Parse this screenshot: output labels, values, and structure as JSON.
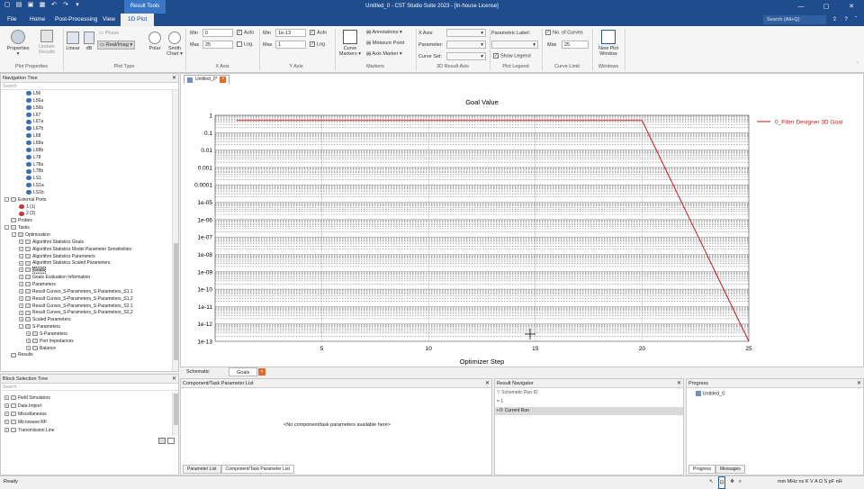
{
  "app": {
    "title": "Untitled_0 - CST Studio Suite 2023 - [In-house License]",
    "context_tab": "Result Tools",
    "search_placeholder": "Search (Alt+Q)"
  },
  "menu": [
    "File",
    "Home",
    "Post-Processing",
    "View",
    "1D Plot"
  ],
  "ribbon": {
    "groups": [
      "Plot Properties",
      "Plot Type",
      "X Axis",
      "Y Axis",
      "Markers",
      "3D Result Axis",
      "Plot Legend",
      "Curve Limit",
      "Windows"
    ],
    "properties": "Properties",
    "update_results": "Update Results",
    "linear": "Linear",
    "db": "dB",
    "phase": "Phase",
    "real_imag": "Real/Imag",
    "polar": "Polar",
    "smith_chart": "Smith Chart",
    "x_min_label": "Min",
    "x_min": "0",
    "x_max_label": "Max",
    "x_max": "25",
    "x_auto": "Auto",
    "x_log": "Log.",
    "y_min_label": "Min",
    "y_min": "1e-13",
    "y_max_label": "Max",
    "y_max": "1",
    "y_auto": "Auto",
    "y_log": "Log",
    "curve_markers": "Curve Markers",
    "annotations": "Annotations",
    "measure_point": "Measure Point",
    "axis_marker": "Axis Marker",
    "x_axis": "X Axis:",
    "parameter": "Parameter:",
    "curve_set": "Curve Set:",
    "parametric_label": "Parametric Label:",
    "show_legend": "Show Legend",
    "no_of_curves": "No. of Curves",
    "curve_max_label": "Max",
    "curve_max": "25",
    "new_plot_window": "New Plot Window"
  },
  "nav_tree": {
    "title": "Navigation Tree",
    "search": "Search",
    "items": [
      {
        "label": "L56",
        "depth": 3,
        "type": "lumped"
      },
      {
        "label": "L56a",
        "depth": 3,
        "type": "lumped"
      },
      {
        "label": "L56b",
        "depth": 3,
        "type": "lumped"
      },
      {
        "label": "L67",
        "depth": 3,
        "type": "lumped"
      },
      {
        "label": "L67a",
        "depth": 3,
        "type": "lumped"
      },
      {
        "label": "L67b",
        "depth": 3,
        "type": "lumped"
      },
      {
        "label": "L68",
        "depth": 3,
        "type": "lumped"
      },
      {
        "label": "L68a",
        "depth": 3,
        "type": "lumped"
      },
      {
        "label": "L68b",
        "depth": 3,
        "type": "lumped"
      },
      {
        "label": "L78",
        "depth": 3,
        "type": "lumped"
      },
      {
        "label": "L78a",
        "depth": 3,
        "type": "lumped"
      },
      {
        "label": "L78b",
        "depth": 3,
        "type": "lumped"
      },
      {
        "label": "LS1",
        "depth": 3,
        "type": "lumped"
      },
      {
        "label": "LS1a",
        "depth": 3,
        "type": "lumped"
      },
      {
        "label": "LS1b",
        "depth": 3,
        "type": "lumped"
      },
      {
        "label": "External Ports",
        "depth": 0,
        "type": "folder",
        "exp": "-"
      },
      {
        "label": "1 (1)",
        "depth": 2,
        "type": "port"
      },
      {
        "label": "2 (2)",
        "depth": 2,
        "type": "port"
      },
      {
        "label": "Probes",
        "depth": 0,
        "type": "folder",
        "exp": ""
      },
      {
        "label": "Tasks",
        "depth": 0,
        "type": "folder",
        "exp": "-"
      },
      {
        "label": "Optimization",
        "depth": 1,
        "type": "task",
        "exp": "-"
      },
      {
        "label": "Algorithm Statistics Goals",
        "depth": 2,
        "type": "result",
        "exp": "+"
      },
      {
        "label": "Algorithm Statistics Model Parameter Sensitivities",
        "depth": 2,
        "type": "result",
        "exp": "+"
      },
      {
        "label": "Algorithm Statistics Parameters",
        "depth": 2,
        "type": "result",
        "exp": "+"
      },
      {
        "label": "Algorithm Statistics Scaled Parameters",
        "depth": 2,
        "type": "result",
        "exp": "+"
      },
      {
        "label": "Goals",
        "depth": 2,
        "type": "result",
        "exp": "+",
        "selected": true
      },
      {
        "label": "Goals Evaluation Information",
        "depth": 2,
        "type": "result",
        "exp": "+"
      },
      {
        "label": "Parameters",
        "depth": 2,
        "type": "result",
        "exp": "+"
      },
      {
        "label": "Result Curves_S-Parameters_S-Parameters_S1,1",
        "depth": 2,
        "type": "result",
        "exp": "+"
      },
      {
        "label": "Result Curves_S-Parameters_S-Parameters_S1,2",
        "depth": 2,
        "type": "result",
        "exp": "+"
      },
      {
        "label": "Result Curves_S-Parameters_S-Parameters_S2,1",
        "depth": 2,
        "type": "result",
        "exp": "+"
      },
      {
        "label": "Result Curves_S-Parameters_S-Parameters_S2,2",
        "depth": 2,
        "type": "result",
        "exp": "+"
      },
      {
        "label": "Scaled Parameters",
        "depth": 2,
        "type": "result",
        "exp": "+"
      },
      {
        "label": "S-Parameters",
        "depth": 2,
        "type": "task",
        "exp": "-"
      },
      {
        "label": "S-Parameters",
        "depth": 3,
        "type": "result",
        "exp": "+"
      },
      {
        "label": "Port Impedances",
        "depth": 3,
        "type": "result",
        "exp": "+"
      },
      {
        "label": "Balance",
        "depth": 3,
        "type": "result",
        "exp": "+"
      },
      {
        "label": "Results",
        "depth": 0,
        "type": "folder",
        "exp": ""
      }
    ]
  },
  "block_tree": {
    "title": "Block Selection Tree",
    "search": "Search",
    "items": [
      "Field Simulators",
      "Data Import",
      "Miscellaneous",
      "Microwave RF",
      "Transmission Line"
    ]
  },
  "doc_tab": "Untitled_0*",
  "bottom_tabs": {
    "schematic": "Schematic",
    "goals": "Goals"
  },
  "param_panel": {
    "title": "Component/Task Parameter List",
    "empty": "<No component/task parameters available here>",
    "tabs": [
      "Parameter List",
      "Component/Task Parameter List"
    ]
  },
  "result_nav": {
    "title": "Result Navigator",
    "column": "Schematic Run ID",
    "rows": [
      "1",
      "0: Current Run"
    ]
  },
  "progress": {
    "title": "Progress",
    "item": "Untitled_0",
    "tabs": [
      "Progress",
      "Messages"
    ]
  },
  "status": {
    "left": "Ready",
    "units": "mm  MHz  ns  K  V  A  Ω  S  pF  nH"
  },
  "colors": {
    "accent": "#1e4c8c",
    "curve": "#c0181e"
  },
  "chart_data": {
    "type": "line",
    "title": "Goal Value",
    "xlabel": "Optimizer Step",
    "ylabel": "",
    "xlim": [
      0,
      25
    ],
    "ylim": [
      1e-13,
      1
    ],
    "yscale": "log",
    "grid": true,
    "legend_position": "right",
    "x_ticks": [
      "5",
      "10",
      "15",
      "20",
      "25"
    ],
    "y_ticks": [
      "1",
      "0.1",
      "0.01",
      "0.001",
      "0.0001",
      "1e-05",
      "1e-06",
      "1e-07",
      "1e-08",
      "1e-09",
      "1e-10",
      "1e-11",
      "1e-12",
      "1e-13"
    ],
    "series": [
      {
        "name": "0_Filter Designer 3D Goal",
        "x": [
          1,
          20,
          25
        ],
        "y": [
          0.5,
          0.5,
          1e-13
        ]
      }
    ]
  }
}
